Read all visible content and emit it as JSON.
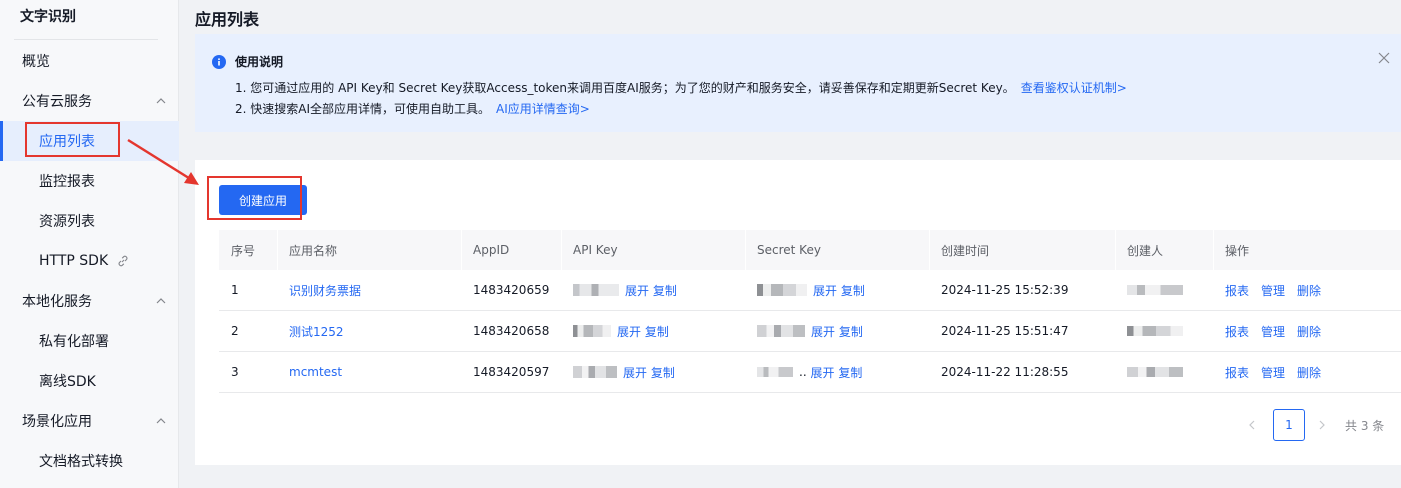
{
  "sidebar": {
    "title": "文字识别",
    "items": [
      {
        "label": "概览"
      },
      {
        "label": "公有云服务"
      },
      {
        "label": "应用列表"
      },
      {
        "label": "监控报表"
      },
      {
        "label": "资源列表"
      },
      {
        "label": "HTTP SDK"
      },
      {
        "label": "本地化服务"
      },
      {
        "label": "私有化部署"
      },
      {
        "label": "离线SDK"
      },
      {
        "label": "场景化应用"
      },
      {
        "label": "文档格式转换"
      }
    ]
  },
  "main": {
    "page_title": "应用列表",
    "notice": {
      "title": "使用说明",
      "line1": "1. 您可通过应用的 API Key和 Secret Key获取Access_token来调用百度AI服务；为了您的财产和服务安全，请妥善保存和定期更新Secret Key。",
      "line1_link": "查看鉴权认证机制>",
      "line2": "2. 快速搜索AI全部应用详情，可使用自助工具。",
      "line2_link": "AI应用详情查询>"
    },
    "create_button": "创建应用",
    "table": {
      "headers": [
        "序号",
        "应用名称",
        "AppID",
        "API Key",
        "Secret Key",
        "创建时间",
        "创建人",
        "操作"
      ],
      "rows": [
        {
          "index": "1",
          "name": "识别财务票据",
          "appid": "1483420659",
          "api_expand": "展开",
          "api_copy": "复制",
          "secret_expand": "展开",
          "secret_copy": "复制",
          "created": "2024-11-25 15:52:39",
          "act_report": "报表",
          "act_manage": "管理",
          "act_delete": "删除"
        },
        {
          "index": "2",
          "name": "测试1252",
          "appid": "1483420658",
          "api_expand": "展开",
          "api_copy": "复制",
          "secret_expand": "展开",
          "secret_copy": "复制",
          "created": "2024-11-25 15:51:47",
          "act_report": "报表",
          "act_manage": "管理",
          "act_delete": "删除"
        },
        {
          "index": "3",
          "name": "mcmtest",
          "appid": "1483420597",
          "api_expand": "展开",
          "api_copy": "复制",
          "secret_prefix": "..",
          "secret_expand": "展开",
          "secret_copy": "复制",
          "created": "2024-11-22 11:28:55",
          "act_report": "报表",
          "act_manage": "管理",
          "act_delete": "删除"
        }
      ]
    },
    "pagination": {
      "current": "1",
      "total": "共 3 条"
    }
  },
  "colors": {
    "accent": "#2468f2",
    "highlight": "#e4362e"
  }
}
